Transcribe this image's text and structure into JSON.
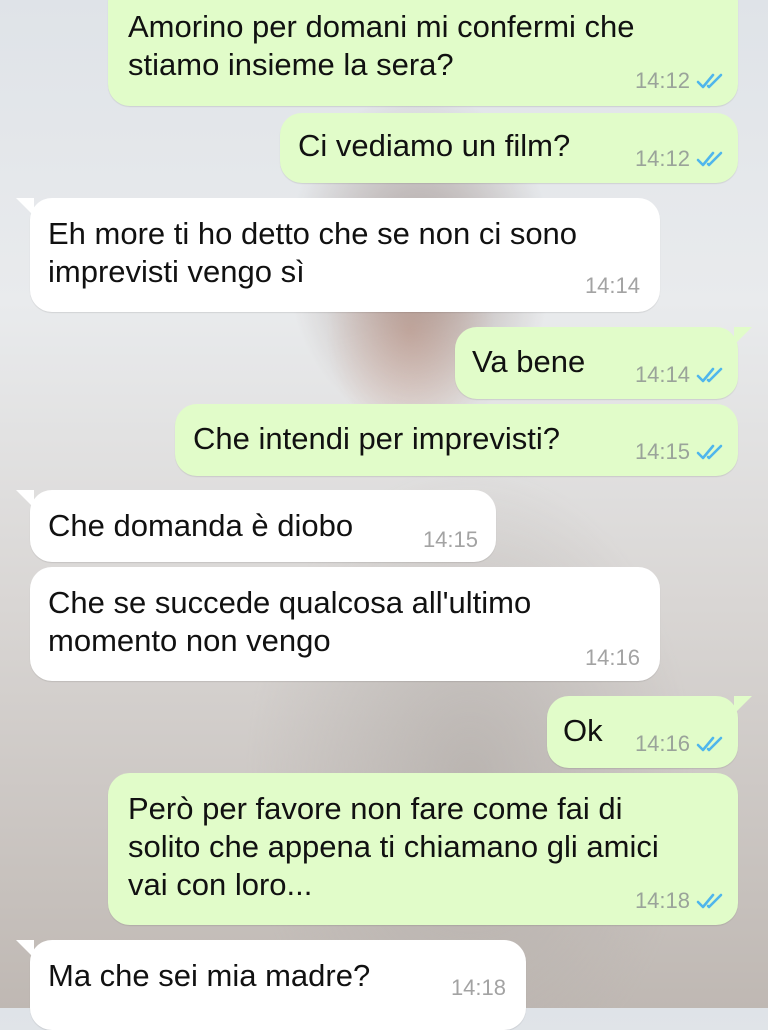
{
  "messages": [
    {
      "text": "Amorino per domani mi confermi che\nstiamo insieme la sera?",
      "time": "14:12",
      "direction": "outgoing",
      "status": "read"
    },
    {
      "text": "Ci vediamo un film?",
      "time": "14:12",
      "direction": "outgoing",
      "status": "read"
    },
    {
      "text": "Eh more ti ho detto che se non ci sono\nimprevisti vengo sì",
      "time": "14:14",
      "direction": "incoming"
    },
    {
      "text": "Va bene",
      "time": "14:14",
      "direction": "outgoing",
      "status": "read"
    },
    {
      "text": "Che intendi per imprevisti?",
      "time": "14:15",
      "direction": "outgoing",
      "status": "read"
    },
    {
      "text": "Che domanda è diobo",
      "time": "14:15",
      "direction": "incoming"
    },
    {
      "text": "Che se succede qualcosa all'ultimo\nmomento non vengo",
      "time": "14:16",
      "direction": "incoming"
    },
    {
      "text": "Ok",
      "time": "14:16",
      "direction": "outgoing",
      "status": "read"
    },
    {
      "text": "Però per favore non fare come fai di\nsolito che appena ti chiamano gli amici\nvai con loro...",
      "time": "14:18",
      "direction": "outgoing",
      "status": "read"
    },
    {
      "text": "Ma che sei mia madre?",
      "time": "14:18",
      "direction": "incoming"
    }
  ],
  "colors": {
    "outgoing_bubble": "#e1fcc9",
    "incoming_bubble": "#ffffff",
    "read_ticks": "#4fb6ec",
    "timestamp": "#9aa39a"
  },
  "icons": {
    "read_status": "double-check-icon"
  }
}
